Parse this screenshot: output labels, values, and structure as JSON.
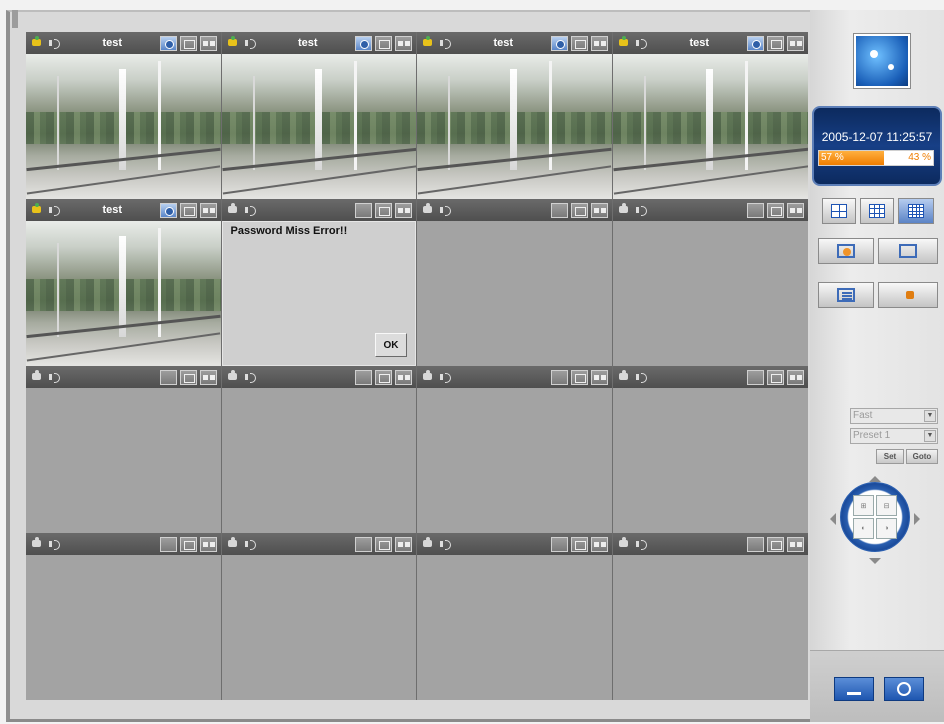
{
  "cells": [
    {
      "title": "test",
      "active": true
    },
    {
      "title": "test",
      "active": true
    },
    {
      "title": "test",
      "active": true
    },
    {
      "title": "test",
      "active": true
    },
    {
      "title": "test",
      "active": true
    },
    {
      "title": "",
      "active": false,
      "dialog": true
    },
    {
      "title": "",
      "active": false
    },
    {
      "title": "",
      "active": false
    },
    {
      "title": "",
      "active": false
    },
    {
      "title": "",
      "active": false
    },
    {
      "title": "",
      "active": false
    },
    {
      "title": "",
      "active": false
    },
    {
      "title": "",
      "active": false
    },
    {
      "title": "",
      "active": false
    },
    {
      "title": "",
      "active": false
    },
    {
      "title": "",
      "active": false
    }
  ],
  "dialog": {
    "message": "Password Miss Error!!",
    "ok_label": "OK"
  },
  "status": {
    "datetime": "2005-12-07 11:25:57",
    "used_percent": 57,
    "used_label": "57 %",
    "free_label": "43 %"
  },
  "ptz": {
    "speed_value": "Fast",
    "preset_value": "Preset 1",
    "set_label": "Set",
    "goto_label": "Goto"
  },
  "colors": {
    "accent_blue": "#1e56b0",
    "usage_orange": "#ef7d00"
  }
}
